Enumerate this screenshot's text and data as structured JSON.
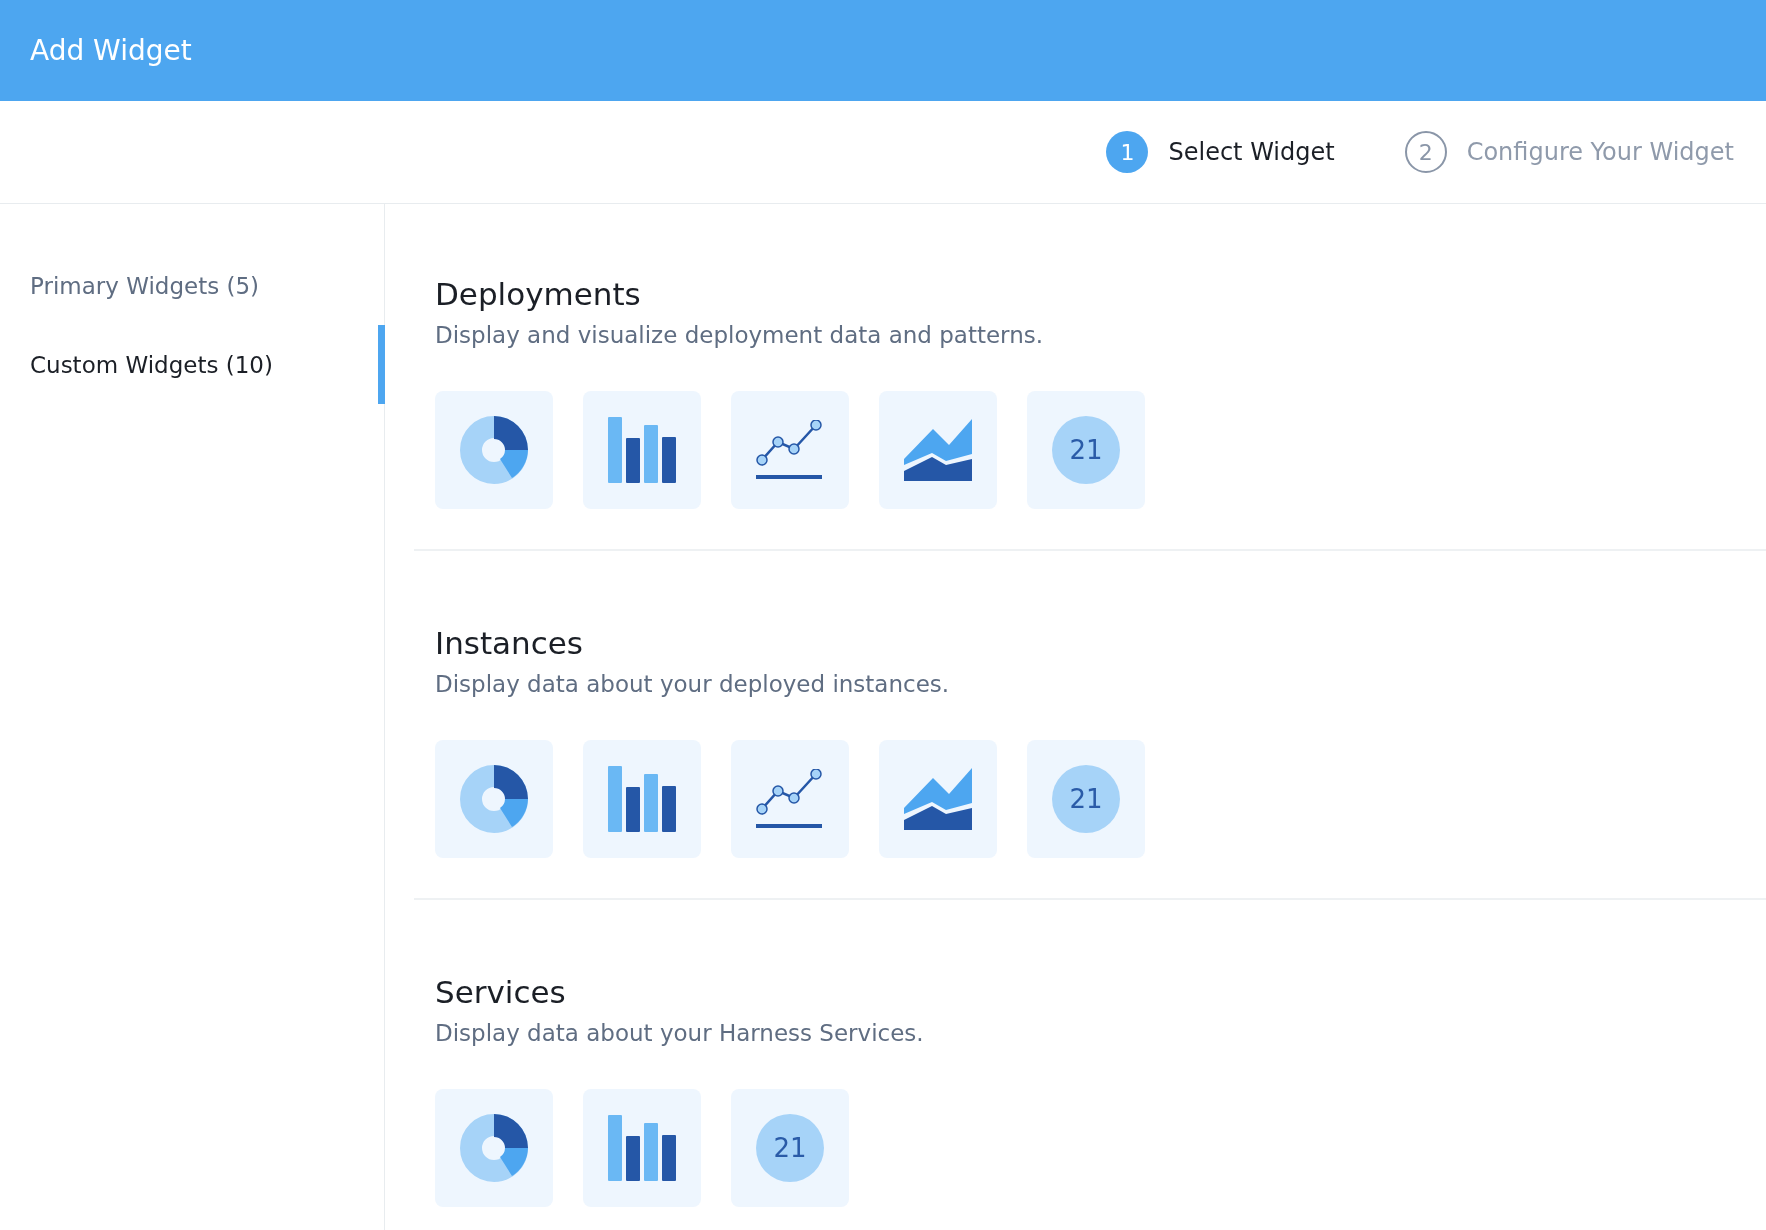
{
  "header": {
    "title": "Add Widget"
  },
  "steps": [
    {
      "number": "1",
      "label": "Select Widget",
      "selected": true
    },
    {
      "number": "2",
      "label": "Configure Your Widget",
      "selected": false
    }
  ],
  "sidebar": {
    "items": [
      {
        "label": "Primary Widgets (5)",
        "selected": false
      },
      {
        "label": "Custom Widgets (10)",
        "selected": true
      }
    ]
  },
  "sections": [
    {
      "title": "Deployments",
      "description": "Display and visualize deployment data and patterns.",
      "widgets": [
        {
          "kind": "donut"
        },
        {
          "kind": "bar"
        },
        {
          "kind": "line"
        },
        {
          "kind": "area"
        },
        {
          "kind": "number",
          "value": "21"
        }
      ]
    },
    {
      "title": "Instances",
      "description": "Display data about your deployed instances.",
      "widgets": [
        {
          "kind": "donut"
        },
        {
          "kind": "bar"
        },
        {
          "kind": "line"
        },
        {
          "kind": "area"
        },
        {
          "kind": "number",
          "value": "21"
        }
      ]
    },
    {
      "title": "Services",
      "description": "Display data about your Harness Services.",
      "widgets": [
        {
          "kind": "donut"
        },
        {
          "kind": "bar"
        },
        {
          "kind": "number",
          "value": "21"
        }
      ]
    }
  ]
}
